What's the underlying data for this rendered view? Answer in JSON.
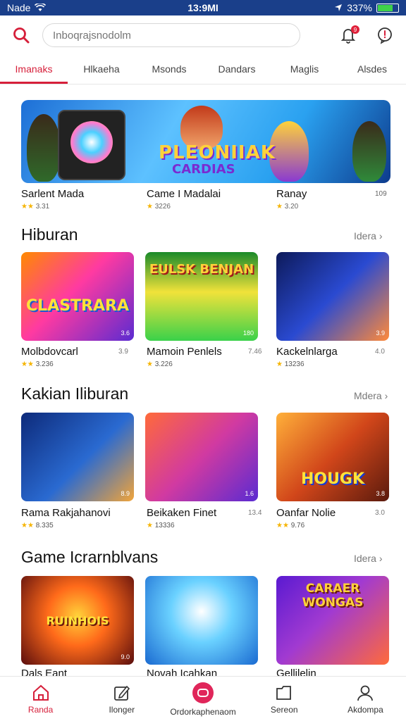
{
  "status": {
    "carrier": "Nade",
    "time": "13:9MI",
    "battery": "337%",
    "battery_level": 0.78
  },
  "search": {
    "placeholder": "Inboqrajsnodolm",
    "notification_count": "9"
  },
  "tabs": [
    {
      "label": "Imanaks"
    },
    {
      "label": "Hlkaeha"
    },
    {
      "label": "Msonds"
    },
    {
      "label": "Dandars"
    },
    {
      "label": "Maglis"
    },
    {
      "label": "Alsdes"
    }
  ],
  "banner": {
    "title": "PLEONIIAK",
    "subtitle": "CARDIAS",
    "items": [
      {
        "name": "Sarlent Mada",
        "rating": "3.31",
        "count": ""
      },
      {
        "name": "Came I Madalai",
        "rating": "3226",
        "count": ""
      },
      {
        "name": "Ranay",
        "rating": "3.20",
        "count": "109"
      }
    ]
  },
  "sections": [
    {
      "title": "Hiburan",
      "more": "Idera",
      "cards": [
        {
          "name": "Molbdovcarl",
          "side": "3.9",
          "rating": "3.236",
          "art": "CLASTRARA",
          "num": "3.6"
        },
        {
          "name": "Mamoin Penlels",
          "side": "7.46",
          "rating": "3.226",
          "art": "EULSK BENJAN",
          "num": "180"
        },
        {
          "name": "Kackelnlarga",
          "side": "4.0",
          "rating": "13236",
          "art": "",
          "num": "3.9"
        }
      ]
    },
    {
      "title": "Kakian Iliburan",
      "more": "Mdera",
      "cards": [
        {
          "name": "Rama Rakjahanovi",
          "side": "",
          "rating": "8.335",
          "art": "",
          "num": "8.9"
        },
        {
          "name": "Beikaken Finet",
          "side": "13.4",
          "rating": "13336",
          "art": "",
          "num": "1.6"
        },
        {
          "name": "Oanfar Nolie",
          "side": "3.0",
          "rating": "9.76",
          "art": "HOUGK",
          "num": "3.8"
        }
      ]
    },
    {
      "title": "Game Icrarnblvans",
      "more": "Idera",
      "cards": [
        {
          "name": "Dals Eant",
          "side": "",
          "rating": "",
          "art": "RUINHOIS",
          "num": "9.0"
        },
        {
          "name": "Novah Icahkan",
          "side": "",
          "rating": "",
          "art": "",
          "num": ""
        },
        {
          "name": "Gellilelin",
          "side": "",
          "rating": "",
          "art": "CARAER WONGAS",
          "num": ""
        }
      ]
    }
  ],
  "nav": [
    {
      "label": "Randa",
      "icon": "home-icon"
    },
    {
      "label": "Ilonger",
      "icon": "edit-icon"
    },
    {
      "label": "Ordorkaphenaom",
      "icon": "chat-icon"
    },
    {
      "label": "Sereon",
      "icon": "folder-icon"
    },
    {
      "label": "Akdompa",
      "icon": "profile-icon"
    }
  ],
  "colors": {
    "accent": "#d61f3a",
    "statusbar": "#1a3f8a"
  }
}
